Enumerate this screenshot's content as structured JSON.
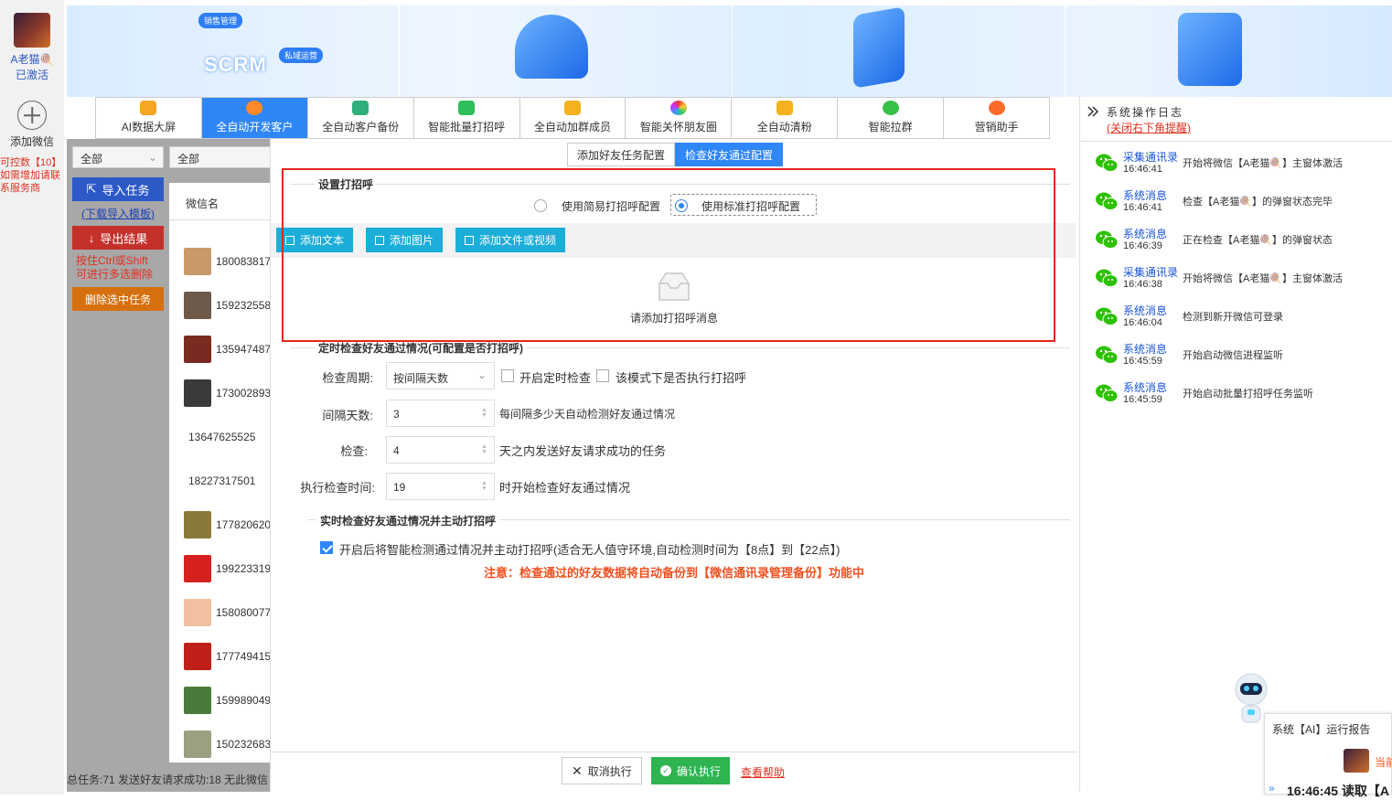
{
  "account": {
    "name": "A老猫🍭",
    "status": "已激活",
    "add_label": "添加微信",
    "quota_lines": [
      "可控数【10】",
      "如需增加请联",
      "系服务商"
    ]
  },
  "banner": {
    "scrm": "SCRM",
    "pill_sales": "销售管理",
    "pill_private": "私域运营"
  },
  "nav": {
    "tabs": [
      "AI数据大屏",
      "全自动开发客户",
      "全自动客户备份",
      "智能批量打招呼",
      "全自动加群成员",
      "智能关怀朋友圈",
      "全自动清粉",
      "智能拉群",
      "营销助手"
    ],
    "active_index": 1
  },
  "tasks": {
    "filter1": "全部",
    "filter2": "全部",
    "column": "微信名",
    "import_btn": "导入任务",
    "download_template": "(下载导入模板)",
    "export_btn": "导出结果",
    "multi_hint": [
      "按住Ctrl或Shift",
      "可进行多选删除"
    ],
    "delete_btn": "删除选中任务",
    "rows": [
      "180083817",
      "159232558",
      "135947487",
      "173002893",
      "13647625525",
      "18227317501",
      "177820620",
      "199223319",
      "158080077",
      "177749415",
      "159989049",
      "150232683"
    ],
    "status": "总任务:71 发送好友请求成功:18 无此微信"
  },
  "config": {
    "subtabs": [
      "添加好友任务配置",
      "检查好友通过配置"
    ],
    "greeting_title": "设置打招呼",
    "radio_simple": "使用简易打招呼配置",
    "radio_standard": "使用标准打招呼配置",
    "add_text": "添加文本",
    "add_image": "添加图片",
    "add_file": "添加文件或视频",
    "empty_msg": "请添加打招呼消息",
    "timed_title": "定时检查好友通过情况(可配置是否打招呼)",
    "period_label": "检查周期:",
    "period_value": "按间隔天数",
    "enable_timed": "开启定时检查",
    "greet_in_mode": "该模式下是否执行打招呼",
    "interval_label": "间隔天数:",
    "interval_value": "3",
    "interval_desc": "每间隔多少天自动检测好友通过情况",
    "check_label": "检查:",
    "check_value": "4",
    "check_desc": "天之内发送好友请求成功的任务",
    "exec_label": "执行检查时间:",
    "exec_value": "19",
    "exec_desc": "时开始检查好友通过情况",
    "realtime_title": "实时检查好友通过情况并主动打招呼",
    "realtime_option": "开启后将智能检测通过情况并主动打招呼(适合无人值守环境,自动检测时间为【8点】到【22点】)",
    "notice": "注意：检查通过的好友数据将自动备份到【微信通讯录管理备份】功能中"
  },
  "footer": {
    "cancel": "取消执行",
    "confirm": "确认执行",
    "help": "查看帮助"
  },
  "log": {
    "title": "系统操作日志",
    "close_hint": "(关闭右下角提醒)",
    "items": [
      {
        "src": "采集通讯录",
        "time": "16:46:41",
        "msg": "开始将微信【A老猫🍭】主窗体激活"
      },
      {
        "src": "系统消息",
        "time": "16:46:41",
        "msg": "检查【A老猫🍭】的弹窗状态完毕"
      },
      {
        "src": "系统消息",
        "time": "16:46:39",
        "msg": "正在检查【A老猫🍭】的弹窗状态"
      },
      {
        "src": "采集通讯录",
        "time": "16:46:38",
        "msg": "开始将微信【A老猫🍭】主窗体激活"
      },
      {
        "src": "系统消息",
        "time": "16:46:04",
        "msg": "检测到新开微信可登录"
      },
      {
        "src": "系统消息",
        "time": "16:45:59",
        "msg": "开始启动微信进程监听"
      },
      {
        "src": "系统消息",
        "time": "16:45:59",
        "msg": "开始启动批量打招呼任务监听"
      }
    ]
  },
  "ai_report": {
    "title": "系统【AI】运行报告",
    "current": "当前",
    "line": "16:46:45 读取【A"
  },
  "colors": {
    "primary": "#2f86f6",
    "warning": "#f0501e",
    "red_outline": "#e8261c"
  }
}
